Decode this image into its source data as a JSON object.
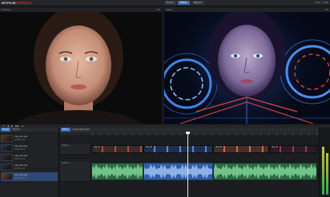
{
  "app": {
    "logo_main": "HITFILM",
    "logo_accent": "EXPRESS"
  },
  "top_tabs": [
    "Home",
    "Editor",
    "Export"
  ],
  "top_right": [
    "Files",
    "Help"
  ],
  "viewer_left": {
    "title": "Trimmer",
    "right": "Full"
  },
  "viewer_right": {
    "title": "Viewer",
    "right": "Full"
  },
  "transport": {
    "buttons": [
      "⏮",
      "◀",
      "▶",
      "▶▶",
      "⏭"
    ]
  },
  "media_panel": {
    "tabs": [
      "Media",
      "Effects"
    ],
    "items": [
      {
        "name": "Clip_01.mp4",
        "duration": "00:00:12:04",
        "color": "#5a3a2c"
      },
      {
        "name": "Clip_02.mp4",
        "duration": "00:00:08:17",
        "color": "#25324d"
      },
      {
        "name": "Clip_03.mp4",
        "duration": "00:00:05:22",
        "color": "#3b2a3a"
      },
      {
        "name": "Clip_04.mp4",
        "duration": "00:00:09:11",
        "color": "#1f2f4a"
      },
      {
        "name": "Clip_05.mp4",
        "duration": "00:00:14:02",
        "color": "#6a4233"
      }
    ]
  },
  "timeline": {
    "tabs": [
      "Editor",
      "Composite Shot"
    ],
    "tracks": [
      "Video 1",
      "Audio 1"
    ],
    "clips": [
      {
        "label": "Clip_01",
        "color": "#3d2a2a",
        "accent": "#b34a3a"
      },
      {
        "label": "Clip_03",
        "color": "#1f2f52",
        "accent": "#5f86cc"
      },
      {
        "label": "Clip_05",
        "color": "#4a2f28",
        "accent": "#c86b4b"
      },
      {
        "label": "Clip_02",
        "color": "#2a1c2a",
        "accent": "#a03846"
      }
    ]
  },
  "colors": {
    "accent": "#3d6fb4",
    "audio": "#2b6a45",
    "audio_selected": "#2f5fa8"
  }
}
